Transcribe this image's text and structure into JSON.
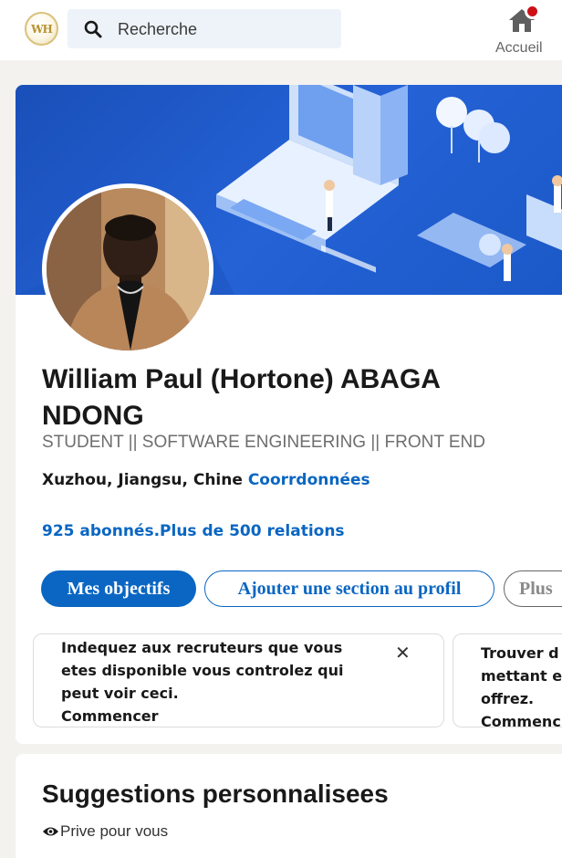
{
  "topbar": {
    "logo_text": "WH",
    "search_placeholder": "Recherche",
    "home_label": "Accueil"
  },
  "profile": {
    "name": "William Paul (Hortone) ABAGA NDONG",
    "headline": "STUDENT || SOFTWARE ENGINEERING || FRONT END",
    "location": "Xuzhou, Jiangsu, Chine",
    "contact_link": "Coorrdonnées",
    "connections": "925 abonnés.Plus de 500 relations"
  },
  "actions": {
    "primary": "Mes objectifs",
    "add_section": "Ajouter une section au profil",
    "more": "Plus"
  },
  "tiles": [
    {
      "text": "Indequez aux recruteurs que vous etes disponible vous controlez qui peut voir ceci.",
      "cta": "Commencer"
    },
    {
      "text": "Trouver d",
      "line2": "mettant e",
      "line3": "offrez.",
      "cta": "Commenc"
    }
  ],
  "suggestions": {
    "title": "Suggestions personnalisees",
    "subtitle": "Prive pour vous"
  },
  "colors": {
    "accent": "#0a66c2",
    "banner": "#2462d6",
    "notification": "#cc1016"
  }
}
